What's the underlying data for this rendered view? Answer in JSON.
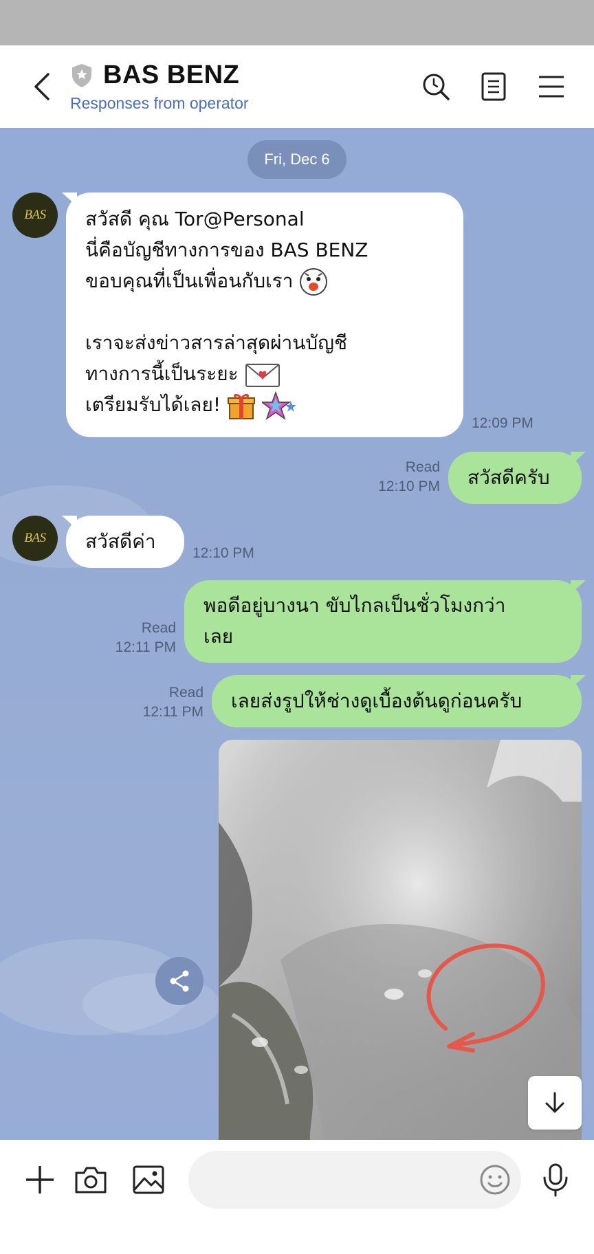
{
  "header": {
    "title": "BAS BENZ",
    "subtitle": "Responses from operator",
    "icons": [
      "back-arrow-icon",
      "shield-icon",
      "search-icon",
      "notes-icon",
      "menu-icon"
    ]
  },
  "chat": {
    "date": "Fri, Dec 6",
    "avatar_label": "BAS",
    "messages": [
      {
        "side": "in",
        "lines": [
          "สวัสดี คุณ Tor@Personal",
          "นี่คือบัญชีทางการของ BAS BENZ",
          "ขอบคุณที่เป็นเพื่อนกับเรา",
          "",
          "เราจะส่งข่าวสารล่าสุดผ่านบัญชี",
          "ทางการนี้เป็นระยะ",
          "เตรียมรับได้เลย!"
        ],
        "time": "12:09 PM"
      },
      {
        "side": "out",
        "text": "สวัสดีครับ",
        "read": "Read",
        "time": "12:10 PM"
      },
      {
        "side": "in",
        "text": "สวัสดีค่า",
        "time": "12:10 PM"
      },
      {
        "side": "out",
        "lines": [
          "พอดีอยู่บางนา ขับไกลเป็นชั่วโมงกว่า",
          "เลย"
        ],
        "read": "Read",
        "time": "12:11 PM"
      },
      {
        "side": "out",
        "text": "เลยส่งรูปให้ช่างดูเบื้องต้นดูก่อนครับ",
        "read": "Read",
        "time": "12:11 PM"
      }
    ]
  },
  "footer": {
    "placeholder": "",
    "icons": [
      "plus-icon",
      "camera-icon",
      "image-icon",
      "emoji-icon",
      "microphone-icon"
    ]
  },
  "colors": {
    "chat_bg": "#93abd6",
    "incoming_bubble": "#ffffff",
    "outgoing_bubble": "#a9e49a",
    "date_pill": "#7a8fb9",
    "subtitle": "#4c6fb3"
  }
}
